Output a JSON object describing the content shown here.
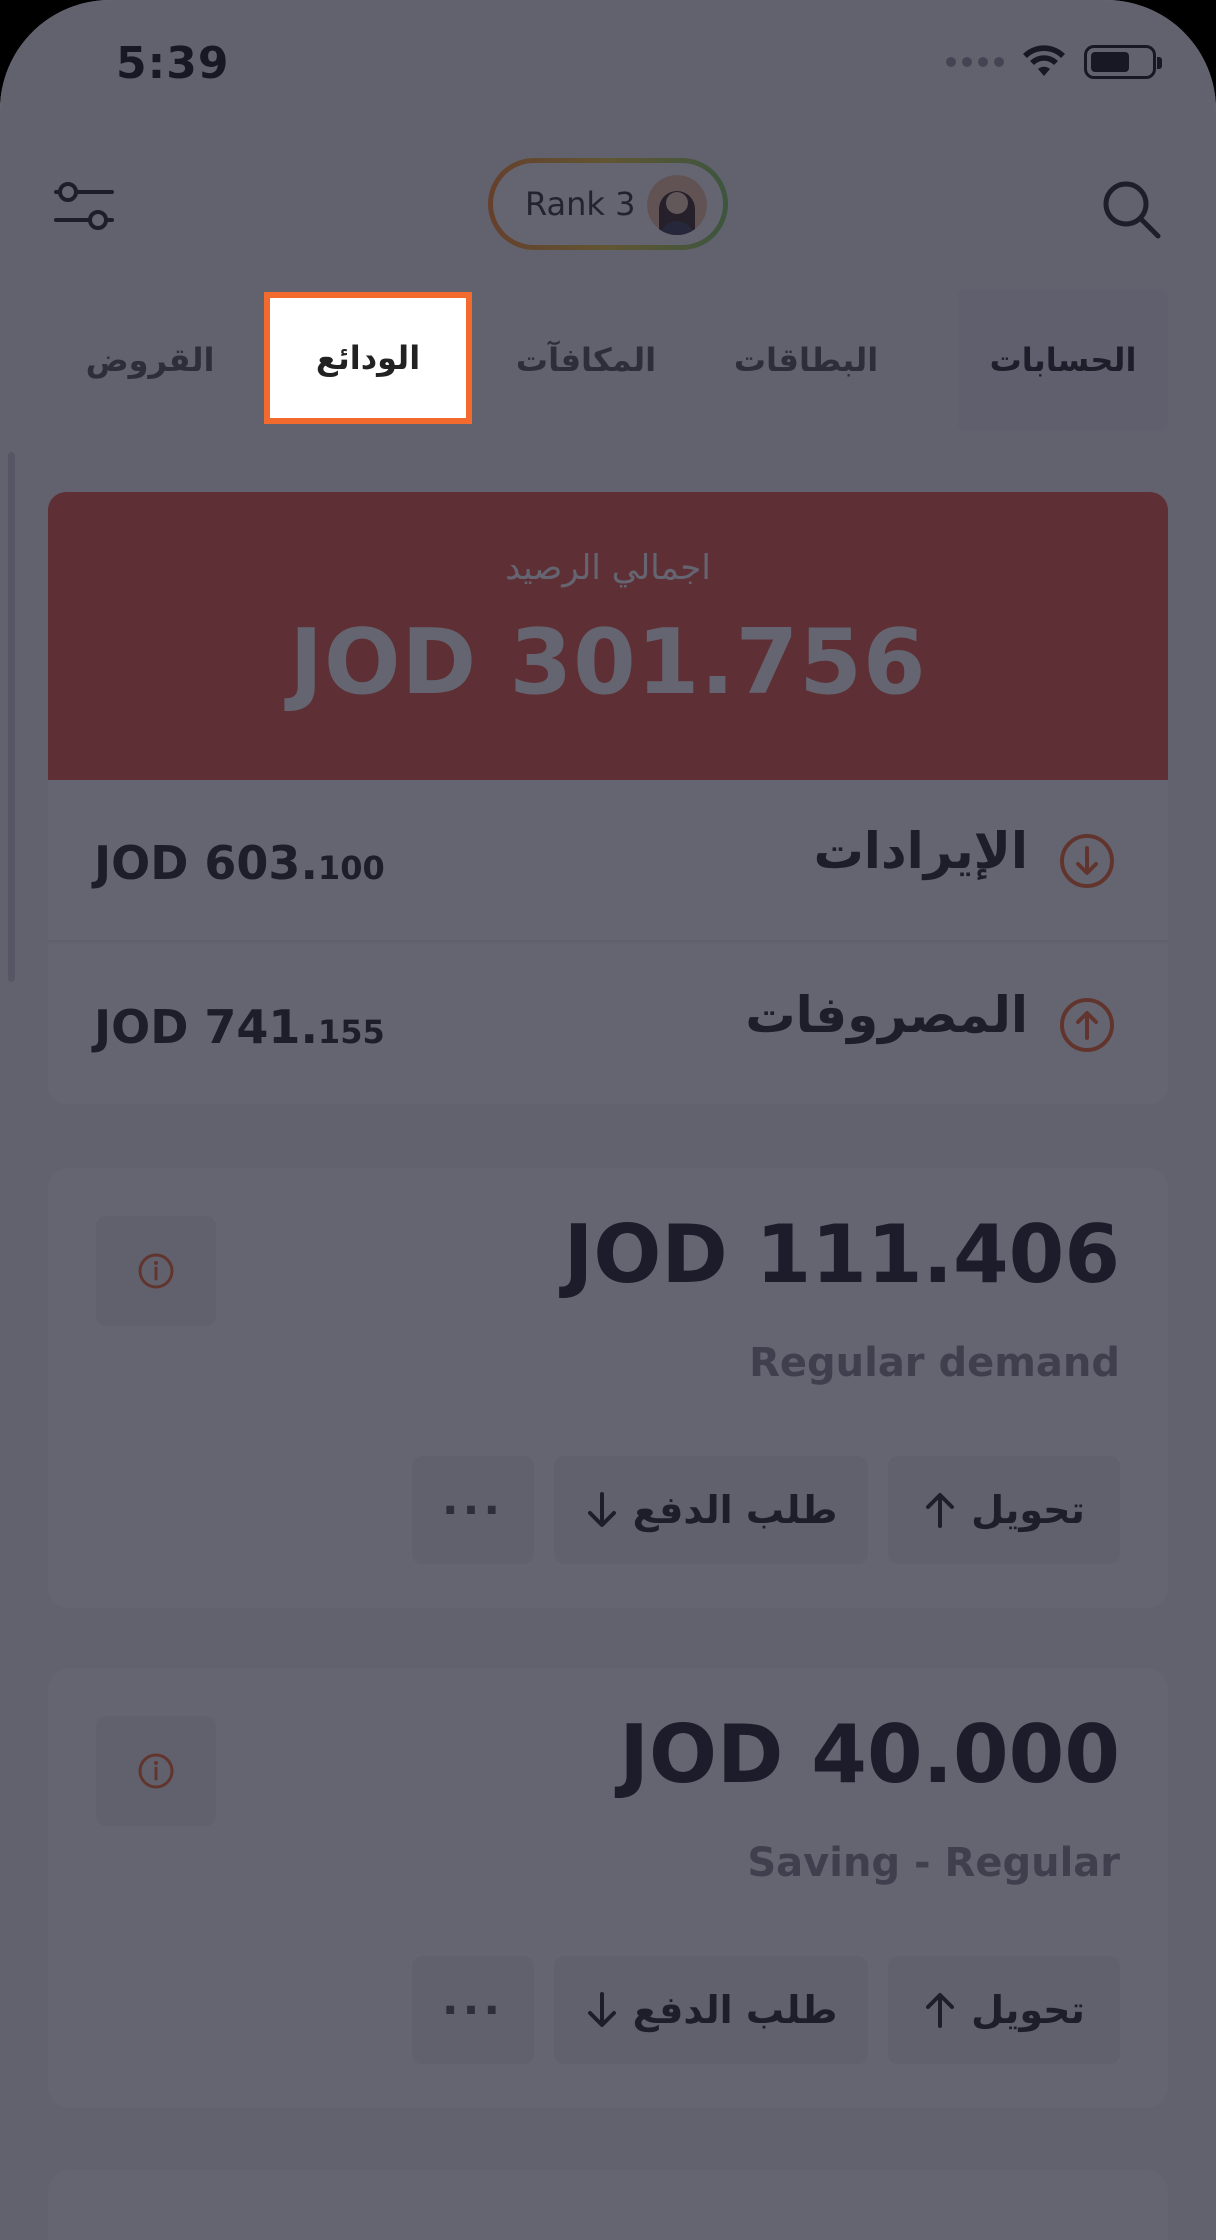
{
  "status_bar": {
    "time": "5:39"
  },
  "header": {
    "rank_label": "Rank 3"
  },
  "tabs": [
    {
      "label": "الحسابات"
    },
    {
      "label": "البطاقات"
    },
    {
      "label": "المكافآت"
    },
    {
      "label": "الودائع"
    },
    {
      "label": "القروض"
    }
  ],
  "balance": {
    "title": "اجمالي الرصيد",
    "amount": "JOD 301.756"
  },
  "income": {
    "label": "الإيرادات",
    "amount_main": "JOD 603.",
    "amount_dec": "100"
  },
  "expenses": {
    "label": "المصروفات",
    "amount_main": "JOD 741.",
    "amount_dec": "155"
  },
  "accounts": [
    {
      "amount": "JOD 111.406",
      "type": "Regular demand",
      "transfer_label": "تحويل",
      "request_label": "طلب الدفع",
      "more_label": "···"
    },
    {
      "amount": "JOD 40.000",
      "type": "Saving - Regular",
      "transfer_label": "تحويل",
      "request_label": "طلب الدفع",
      "more_label": "···"
    }
  ],
  "colors": {
    "accent": "#f26a2e",
    "balance_card": "#e85b44",
    "overlay": "rgba(28,28,46,0.68)"
  }
}
